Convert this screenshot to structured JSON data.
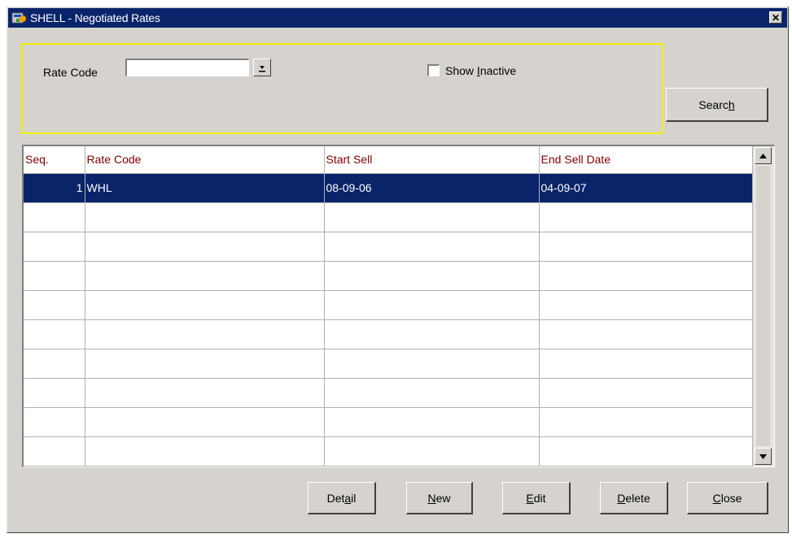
{
  "window": {
    "title": "SHELL - Negotiated Rates",
    "close_glyph": "✕"
  },
  "search_panel": {
    "rate_code_label": "Rate Code",
    "rate_code_value": "",
    "show_inactive_label_pre": "Show ",
    "show_inactive_label_u": "I",
    "show_inactive_label_post": "nactive",
    "show_inactive_checked": false,
    "search_pre": "Searc",
    "search_u": "h",
    "search_post": ""
  },
  "grid": {
    "columns": [
      "Seq.",
      "Rate Code",
      "Start Sell",
      "End Sell Date"
    ],
    "rows": [
      {
        "seq": "1",
        "rate_code": "WHL",
        "start_sell": "08-09-06",
        "end_sell": "04-09-07",
        "selected": true
      },
      {
        "seq": "",
        "rate_code": "",
        "start_sell": "",
        "end_sell": ""
      },
      {
        "seq": "",
        "rate_code": "",
        "start_sell": "",
        "end_sell": ""
      },
      {
        "seq": "",
        "rate_code": "",
        "start_sell": "",
        "end_sell": ""
      },
      {
        "seq": "",
        "rate_code": "",
        "start_sell": "",
        "end_sell": ""
      },
      {
        "seq": "",
        "rate_code": "",
        "start_sell": "",
        "end_sell": ""
      },
      {
        "seq": "",
        "rate_code": "",
        "start_sell": "",
        "end_sell": ""
      },
      {
        "seq": "",
        "rate_code": "",
        "start_sell": "",
        "end_sell": ""
      },
      {
        "seq": "",
        "rate_code": "",
        "start_sell": "",
        "end_sell": ""
      },
      {
        "seq": "",
        "rate_code": "",
        "start_sell": "",
        "end_sell": ""
      }
    ]
  },
  "buttons": {
    "detail": {
      "pre": "Det",
      "u": "a",
      "post": "il"
    },
    "new": {
      "pre": "",
      "u": "N",
      "post": "ew"
    },
    "edit": {
      "pre": "",
      "u": "E",
      "post": "dit"
    },
    "delete": {
      "pre": "",
      "u": "D",
      "post": "elete"
    },
    "close": {
      "pre": "",
      "u": "C",
      "post": "lose"
    }
  },
  "icons": {
    "app": "app-icon",
    "close": "close-icon",
    "dropdown": "dropdown-arrow-icon",
    "scroll_up": "scroll-up-icon",
    "scroll_down": "scroll-down-icon"
  },
  "colors": {
    "titlebar": "#0a246a",
    "panel_border": "#f0f000",
    "header_text": "#800000",
    "selection": "#0a246a"
  }
}
